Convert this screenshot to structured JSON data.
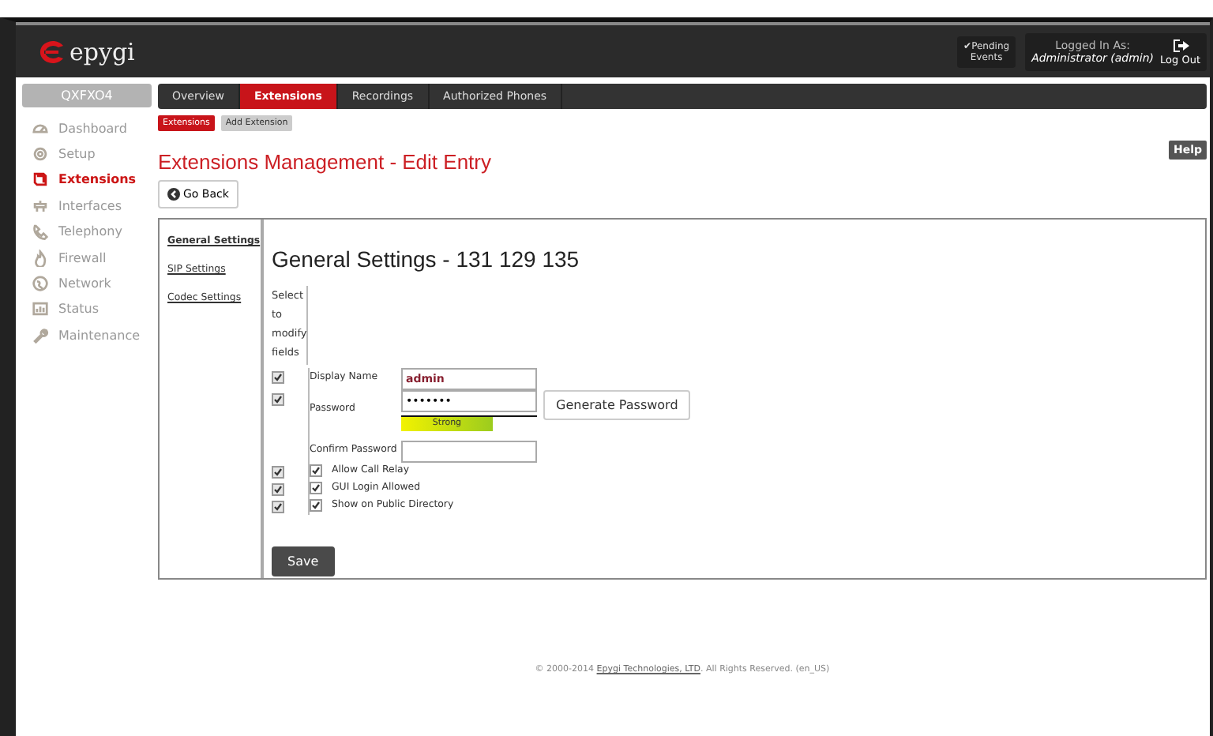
{
  "header": {
    "logo": "epygi",
    "pending": {
      "check": "✔",
      "line1": "Pending",
      "line2": "Events"
    },
    "login": {
      "label": "Logged In As:",
      "user": "Administrator (admin)"
    },
    "logout": "Log Out"
  },
  "device": "QXFXO4",
  "sidebar": {
    "items": [
      {
        "label": "Dashboard",
        "selected": false
      },
      {
        "label": "Setup",
        "selected": false
      },
      {
        "label": "Extensions",
        "selected": true
      },
      {
        "label": "Interfaces",
        "selected": false
      },
      {
        "label": "Telephony",
        "selected": false
      },
      {
        "label": "Firewall",
        "selected": false
      },
      {
        "label": "Network",
        "selected": false
      },
      {
        "label": "Status",
        "selected": false
      },
      {
        "label": "Maintenance",
        "selected": false
      }
    ]
  },
  "tabs": [
    {
      "label": "Overview",
      "selected": false
    },
    {
      "label": "Extensions",
      "selected": true
    },
    {
      "label": "Recordings",
      "selected": false
    },
    {
      "label": "Authorized Phones",
      "selected": false
    }
  ],
  "subtabs": [
    {
      "label": "Extensions",
      "selected": true
    },
    {
      "label": "Add Extension",
      "selected": false
    }
  ],
  "title": "Extensions Management - Edit Entry",
  "help": "Help",
  "go_back": "Go Back",
  "settings_nav": [
    {
      "label": "General Settings",
      "selected": true
    },
    {
      "label": "SIP Settings",
      "selected": false
    },
    {
      "label": "Codec Settings",
      "selected": false
    }
  ],
  "section_title": "General Settings - 131 129 135",
  "select_hint": "Select to modify fields",
  "fields": [
    {
      "kind": "text",
      "modify": true,
      "label": "Display Name",
      "value": "admin"
    },
    {
      "kind": "password",
      "modify": true,
      "label": "Password",
      "value": "•••••••",
      "button": "Generate Password",
      "strength": {
        "label": "Strong",
        "level": 0.67
      }
    },
    {
      "kind": "confirm",
      "label": "Confirm Password"
    },
    {
      "kind": "check",
      "modify": true,
      "label": "Allow Call Relay",
      "checked": true
    },
    {
      "kind": "check",
      "modify": true,
      "label": "GUI Login Allowed",
      "checked": true
    },
    {
      "kind": "check",
      "modify": true,
      "label": "Show on Public Directory",
      "checked": true
    }
  ],
  "save": "Save",
  "footer": {
    "before": "© 2000-2014 ",
    "link": "Epygi Technologies, LTD",
    "after": ". All Rights Reserved. (en_US)"
  }
}
